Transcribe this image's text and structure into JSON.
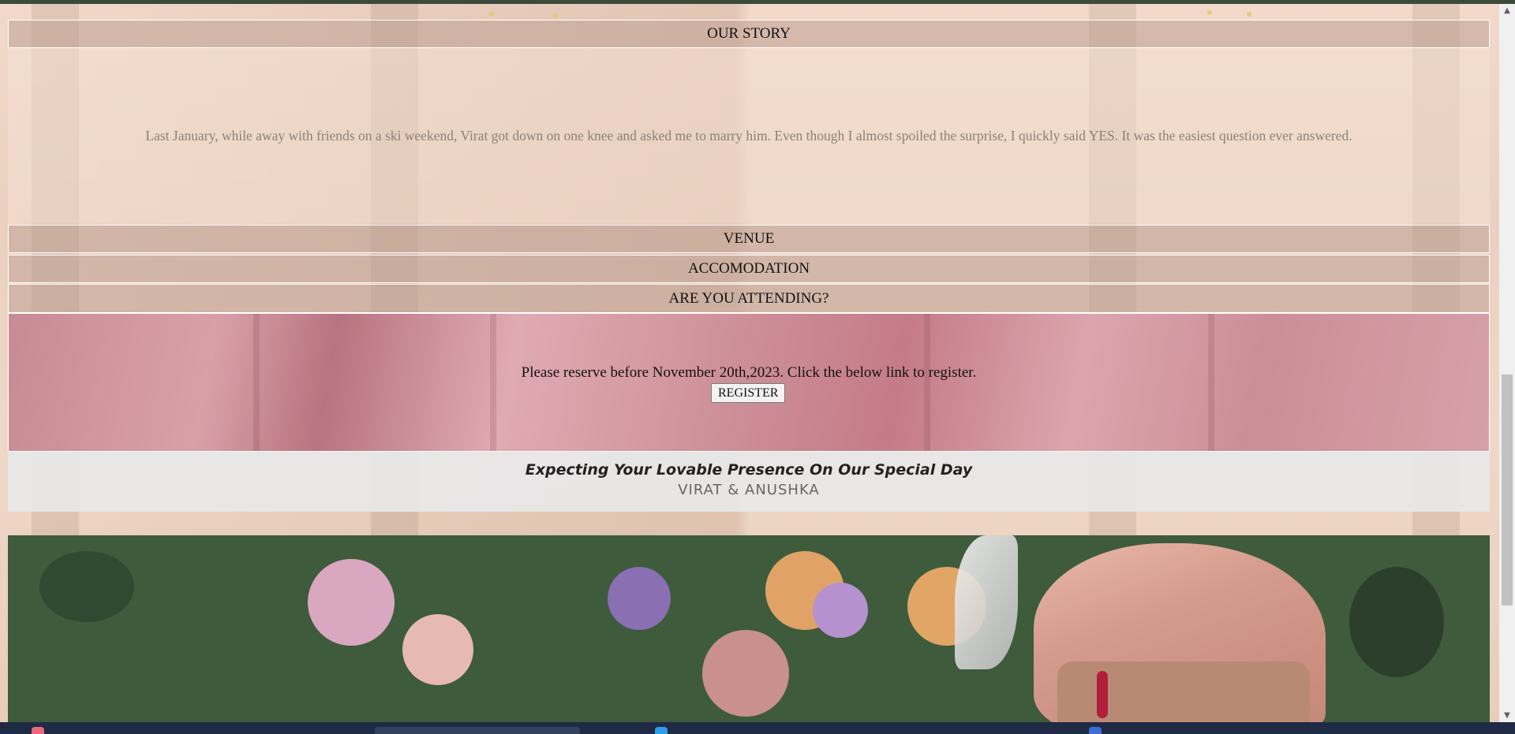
{
  "sections": {
    "story": {
      "header": "OUR STORY",
      "text": "Last January, while away with friends on a ski weekend, Virat got down on one knee and asked me to marry him. Even though I almost spoiled the surprise, I quickly said YES. It was the easiest question ever answered."
    },
    "venue": {
      "header": "VENUE"
    },
    "accommodation": {
      "header": "ACCOMODATION"
    },
    "attending": {
      "header": "ARE YOU ATTENDING?",
      "message": "Please reserve before November 20th,2023. Click the below link to register.",
      "register_label": "REGISTER"
    }
  },
  "closing": {
    "line1": "Expecting Your Lovable Presence On Our Special Day",
    "line2": "VIRAT & ANUSHKA"
  },
  "scrollbar": {
    "up_icon": "▲",
    "down_icon": "▼"
  },
  "colors": {
    "header_bg": "#bea094",
    "attend_bg": "#d39aa2",
    "closing_bg": "#e8e8e8",
    "taskbar": "#1f2a44"
  }
}
